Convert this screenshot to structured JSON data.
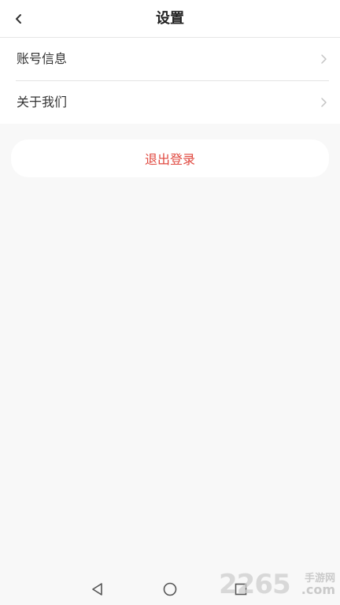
{
  "header": {
    "title": "设置",
    "back_icon": "chevron-left-icon"
  },
  "settings": {
    "items": [
      {
        "label": "账号信息",
        "icon": "chevron-right-icon"
      },
      {
        "label": "关于我们",
        "icon": "chevron-right-icon"
      }
    ]
  },
  "logout": {
    "label": "退出登录",
    "color": "#e0483f"
  },
  "nav_bar": {
    "back_icon": "triangle-back-icon",
    "home_icon": "circle-home-icon",
    "recent_icon": "square-recent-icon"
  },
  "watermark": {
    "digits": "2265",
    "cn": "手游网",
    "suffix": ".com"
  }
}
